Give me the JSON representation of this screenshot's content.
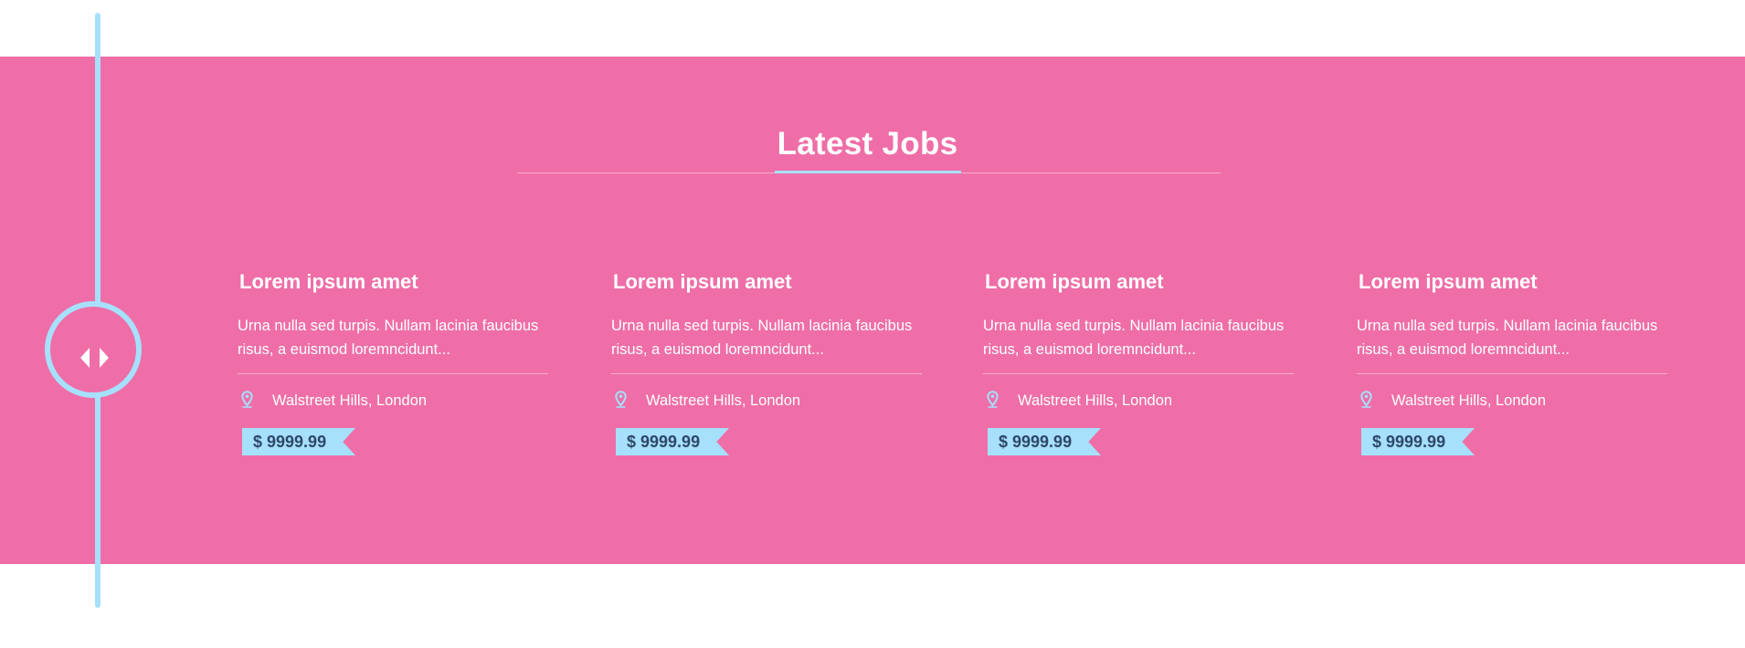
{
  "section": {
    "title": "Latest Jobs"
  },
  "colors": {
    "band": "#ef6ea7",
    "accent": "#a6e0fb",
    "text": "#ffffff",
    "price_text": "#2f4868"
  },
  "navigator": {
    "prev_icon": "caret-left-icon",
    "next_icon": "caret-right-icon"
  },
  "jobs": [
    {
      "title": "Lorem ipsum amet",
      "description": "Urna nulla sed turpis. Nullam lacinia faucibus risus, a euismod loremncidunt...",
      "location_icon": "map-pin-icon",
      "location": "Walstreet Hills, London",
      "price": "$ 9999.99"
    },
    {
      "title": "Lorem ipsum amet",
      "description": "Urna nulla sed turpis. Nullam lacinia faucibus risus, a euismod loremncidunt...",
      "location_icon": "map-pin-icon",
      "location": "Walstreet Hills, London",
      "price": "$ 9999.99"
    },
    {
      "title": "Lorem ipsum amet",
      "description": "Urna nulla sed turpis. Nullam lacinia faucibus risus, a euismod loremncidunt...",
      "location_icon": "map-pin-icon",
      "location": "Walstreet Hills, London",
      "price": "$ 9999.99"
    },
    {
      "title": "Lorem ipsum amet",
      "description": "Urna nulla sed turpis. Nullam lacinia faucibus risus, a euismod loremncidunt...",
      "location_icon": "map-pin-icon",
      "location": "Walstreet Hills, London",
      "price": "$ 9999.99"
    }
  ]
}
